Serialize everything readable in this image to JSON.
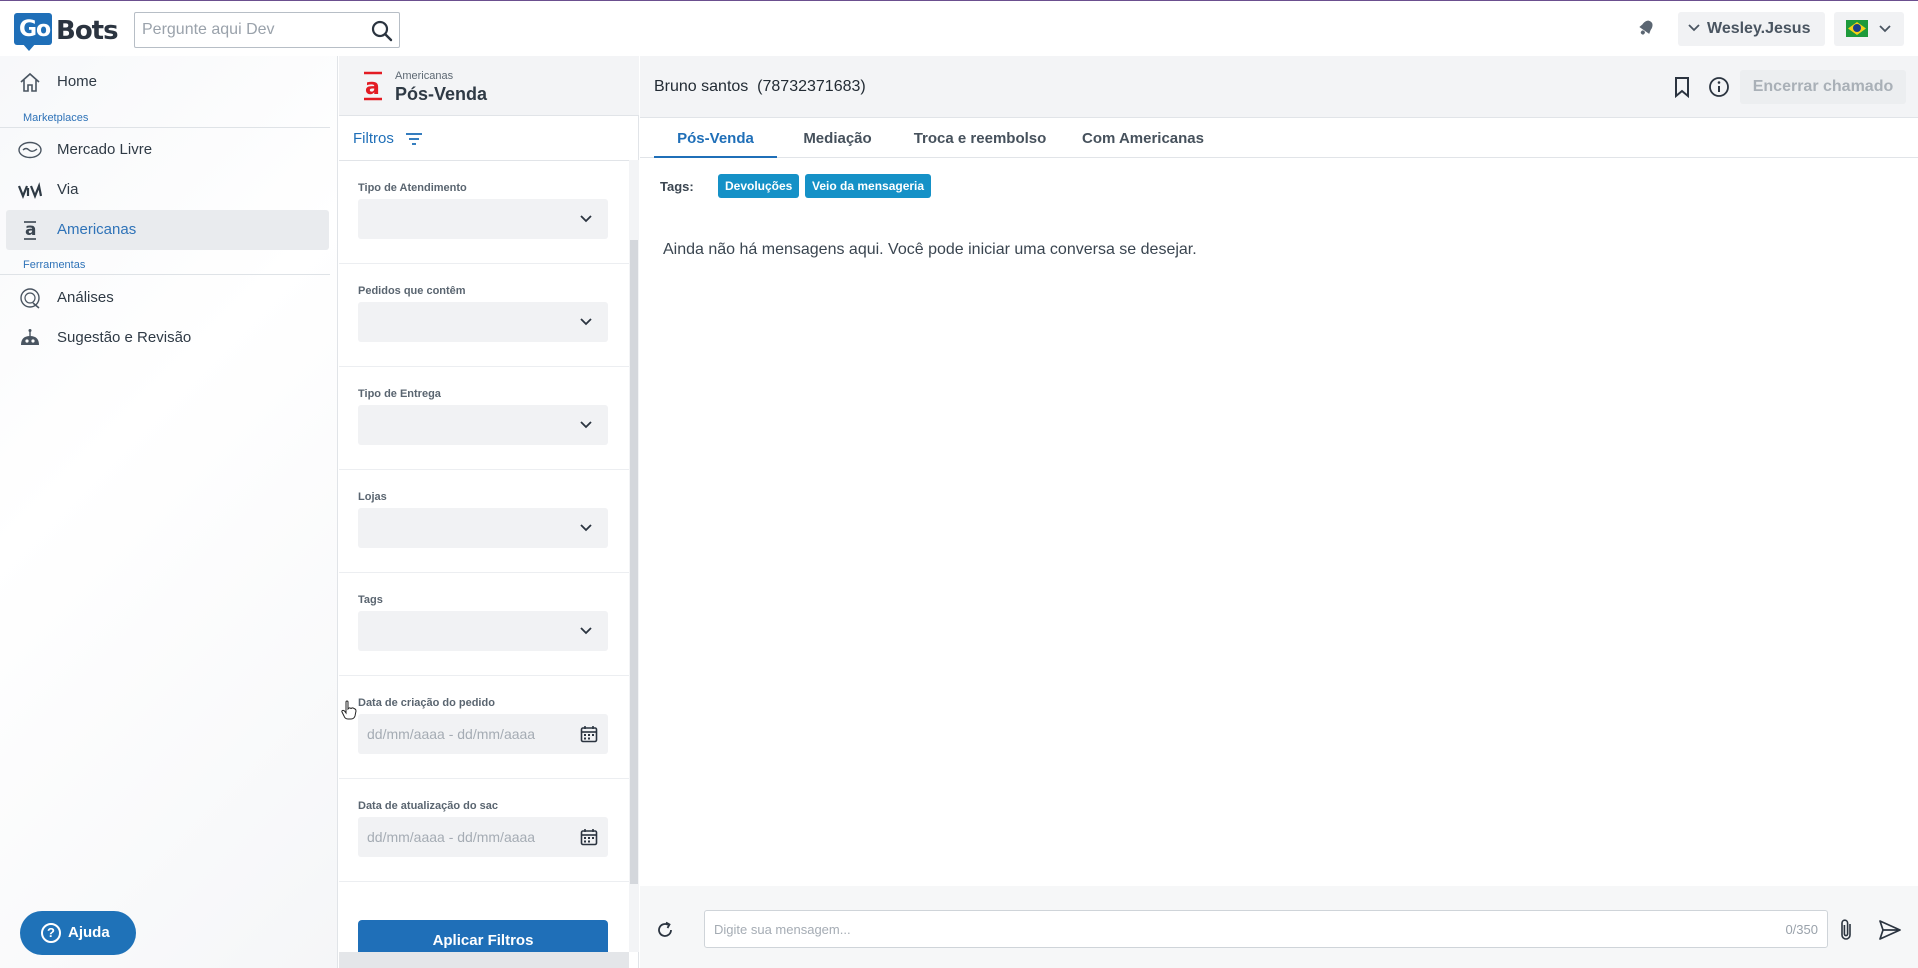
{
  "header": {
    "logo_prefix": "Go",
    "logo_text": "Bots",
    "search_placeholder": "Pergunte aqui Dev",
    "username": "Wesley.Jesus"
  },
  "sidebar": {
    "home_label": "Home",
    "section_marketplaces": "Marketplaces",
    "items_marketplaces": [
      "Mercado Livre",
      "Via",
      "Americanas"
    ],
    "section_tools": "Ferramentas",
    "items_tools": [
      "Análises",
      "Sugestão e Revisão"
    ],
    "active_item": "Americanas",
    "help_label": "Ajuda"
  },
  "filters": {
    "store_small": "Americanas",
    "store_title": "Pós-Venda",
    "filters_label": "Filtros",
    "groups": [
      {
        "label": "Tipo de Atendimento",
        "type": "select"
      },
      {
        "label": "Pedidos que contêm",
        "type": "select"
      },
      {
        "label": "Tipo de Entrega",
        "type": "select"
      },
      {
        "label": "Lojas",
        "type": "select"
      },
      {
        "label": "Tags",
        "type": "select"
      },
      {
        "label": "Data de criação do pedido",
        "type": "date",
        "placeholder": "dd/mm/aaaa - dd/mm/aaaa"
      },
      {
        "label": "Data de atualização do sac",
        "type": "date",
        "placeholder": "dd/mm/aaaa - dd/mm/aaaa"
      }
    ],
    "apply_label": "Aplicar Filtros"
  },
  "conversation": {
    "customer_name": "Bruno santos",
    "customer_id": "(78732371683)",
    "close_label": "Encerrar chamado",
    "tabs": [
      "Pós-Venda",
      "Mediação",
      "Troca e reembolso",
      "Com Americanas"
    ],
    "active_tab": "Pós-Venda",
    "tags_label": "Tags:",
    "tags": [
      "Devoluções",
      "Veio da mensageria"
    ],
    "empty_message": "Ainda não há mensagens aqui. Você pode iniciar uma conversa se desejar.",
    "input_placeholder": "Digite sua mensagem...",
    "char_count": "0/350"
  },
  "colors": {
    "accent": "#1f6fb8",
    "tag_bg": "#1591c7",
    "americanas_red": "#e31b23"
  }
}
